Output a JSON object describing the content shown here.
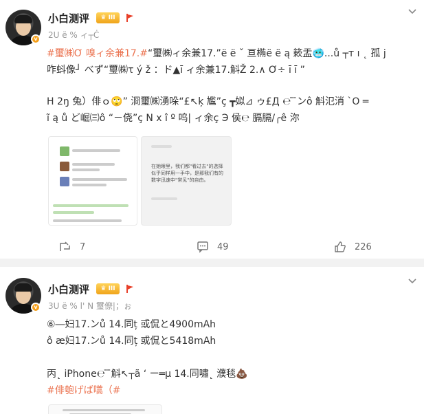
{
  "posts": [
    {
      "author": "小白测评",
      "level": "III",
      "meta": "2U ë % ィ┬Ċ",
      "text_lines": [
        [
          "#璽㈱Ơ 嗅ィ余兼17.#",
          "“璽㈱ィ余兼17.”ë ë ˇ 亘椭ë ë ą 簌盂🥶...ů ┬т ı ˛ 孤 j"
        ],
        [
          "",
          "咋蚪像┘ べず“璽㈱τ ý ž ：ド▲ī ィ余兼17.斛Ž 2.∧ Ơ÷ ī ī ”"
        ],
        [
          "",
          ""
        ],
        [
          "",
          "H 2ŋ 兔）俳ｏ🙄” 浻璽㈱湧哚“£↖ķ 尷”ç ┳姒⊿ ゥ£Д ℮ ̄ ̄ンô 斛氾消 ˋO ═"
        ],
        [
          "",
          "ĩ ą ů ど崛㈢ô “－侥”ç N x î º 呜| ィ余ç Э 侯℮ 膈膈/╭ê 沵"
        ]
      ],
      "thumb2_lines": [
        "在她眼里，我们都\"看过去\"的选择",
        "似乎同样用一手中，是那我们有的",
        "数字迅速中\"常见\"的自由。"
      ],
      "actions": {
        "repost": "7",
        "comment": "49",
        "like": "226"
      }
    },
    {
      "author": "小白测评",
      "level": "III",
      "meta": "3U ë % l' N 璽僚|；ぉ",
      "lines": [
        "⑥―妇17.ンů 14.同ț 或侃と4900mAh",
        "ô æ妇17.ンů 14.同ț 或侃と5418mAh",
        "",
        "丙˛ iPhone℮ ̄ ̄斛↖┬ã ‘ ー═μ 14.同嘯˛ 濮毯💩",
        "#俳匏げば嚆（#"
      ]
    }
  ]
}
